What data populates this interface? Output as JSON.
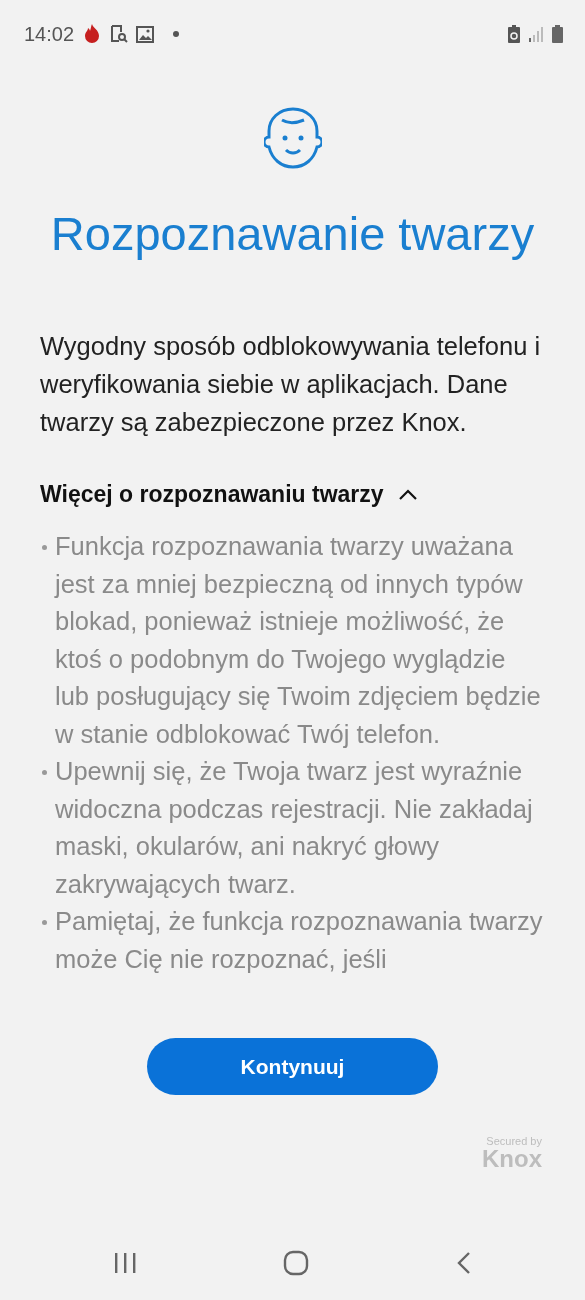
{
  "status_bar": {
    "time": "14:02"
  },
  "title": "Rozpoznawanie twarzy",
  "description": "Wygodny sposób odblokowywania telefonu i weryfikowania siebie w aplikacjach. Dane twarzy są zabezpieczone przez Knox.",
  "more": {
    "label": "Więcej o rozpoznawaniu twarzy",
    "expanded": true
  },
  "bullets": [
    "Funkcja rozpoznawania twarzy uważana jest za mniej bezpieczną od innych typów blokad, ponieważ istnieje możliwość, że ktoś o podobnym do Twojego wyglądzie lub posługujący się Twoim zdjęciem będzie w stanie odblokować Twój telefon.",
    "Upewnij się, że Twoja twarz jest wyraźnie widoczna podczas rejestracji. Nie zakładaj maski, okularów, ani nakryć głowy zakrywających twarz.",
    "Pamiętaj, że funkcja rozpoznawania twarzy może Cię nie rozpoznać, jeśli"
  ],
  "button": "Kontynuuj",
  "badge": {
    "caption": "Secured by",
    "brand": "Knox"
  }
}
